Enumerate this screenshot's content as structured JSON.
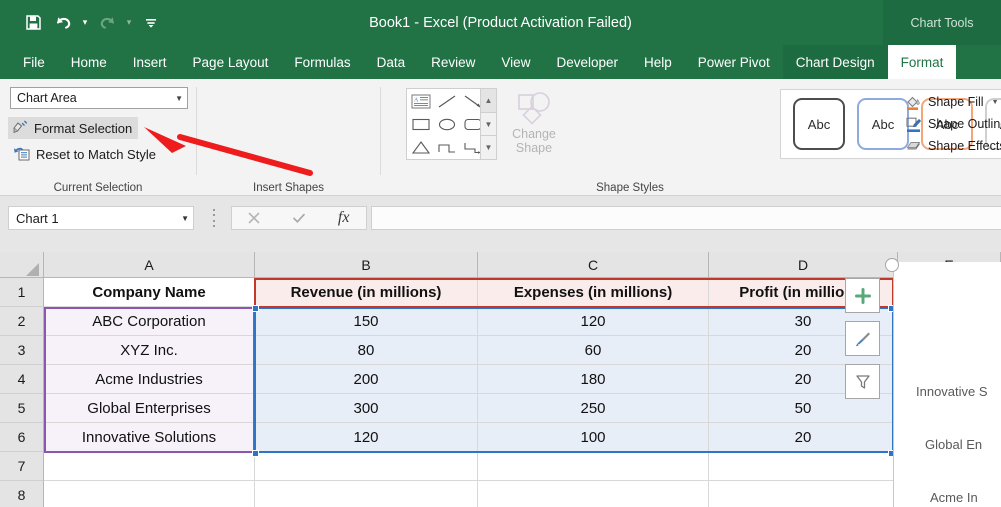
{
  "titlebar": {
    "title": "Book1  -  Excel (Product Activation Failed)",
    "context_tools": "Chart Tools",
    "qat": [
      {
        "name": "save-icon",
        "label": "Save"
      },
      {
        "name": "undo-icon",
        "label": "Undo"
      },
      {
        "name": "undo-dropdown-icon",
        "label": "Undo options"
      },
      {
        "name": "redo-icon",
        "label": "Redo"
      },
      {
        "name": "redo-dropdown-icon",
        "label": "Redo options"
      },
      {
        "name": "customize-qat-icon",
        "label": "Customize Quick Access Toolbar"
      }
    ]
  },
  "tabs": [
    {
      "label": "File",
      "active": false,
      "context": false
    },
    {
      "label": "Home",
      "active": false,
      "context": false
    },
    {
      "label": "Insert",
      "active": false,
      "context": false
    },
    {
      "label": "Page Layout",
      "active": false,
      "context": false
    },
    {
      "label": "Formulas",
      "active": false,
      "context": false
    },
    {
      "label": "Data",
      "active": false,
      "context": false
    },
    {
      "label": "Review",
      "active": false,
      "context": false
    },
    {
      "label": "View",
      "active": false,
      "context": false
    },
    {
      "label": "Developer",
      "active": false,
      "context": false
    },
    {
      "label": "Help",
      "active": false,
      "context": false
    },
    {
      "label": "Power Pivot",
      "active": false,
      "context": false
    },
    {
      "label": "Chart Design",
      "active": false,
      "context": true
    },
    {
      "label": "Format",
      "active": true,
      "context": true
    }
  ],
  "ribbon": {
    "current_selection": {
      "group_label": "Current Selection",
      "selected_object": "Chart Area",
      "format_selection": "Format Selection",
      "reset_to_match_style": "Reset to Match Style"
    },
    "insert_shapes": {
      "group_label": "Insert Shapes",
      "change_shape": "Change Shape",
      "shapes": [
        "textbox-shape-icon",
        "line-shape-icon",
        "arrow-shape-icon",
        "rectangle-shape-icon",
        "oval-shape-icon",
        "rounded-rectangle-shape-icon",
        "triangle-shape-icon",
        "connector-elbow-shape-icon",
        "connector-elbow-arrow-shape-icon"
      ]
    },
    "shape_styles": {
      "group_label": "Shape Styles",
      "sample_text": "Abc",
      "swatches": [
        {
          "border": "#4d4d4d"
        },
        {
          "border": "#8faadc"
        },
        {
          "border": "#f4a67a"
        },
        {
          "border": "#cfcfcf"
        },
        {
          "border": "#f5c342"
        },
        {
          "border": "#8faadc"
        },
        {
          "border": "#a9d18e"
        }
      ],
      "commands": [
        {
          "label": "Shape Fill",
          "icon": "shape-fill-icon",
          "accent": "#ed7d31"
        },
        {
          "label": "Shape Outline",
          "icon": "shape-outline-icon",
          "accent": "#2e75c7"
        },
        {
          "label": "Shape Effects",
          "icon": "shape-effects-icon",
          "accent": "#9a9a9a"
        }
      ]
    }
  },
  "formula_bar": {
    "name_box": "Chart 1",
    "formula_value": "",
    "cancel_icon": "cancel-icon",
    "enter_icon": "enter-checkmark-icon",
    "function_icon": "insert-function-icon"
  },
  "sheet": {
    "column_headers": [
      "A",
      "B",
      "C",
      "D",
      "E"
    ],
    "row_headers": [
      "1",
      "2",
      "3",
      "4",
      "5",
      "6",
      "7",
      "8"
    ],
    "header_row": [
      "Company Name",
      "Revenue (in millions)",
      "Expenses (in millions)",
      "Profit (in millions)"
    ],
    "rows": [
      {
        "row": "2",
        "cells": [
          "ABC Corporation",
          "150",
          "120",
          "30"
        ]
      },
      {
        "row": "3",
        "cells": [
          "XYZ Inc.",
          "80",
          "60",
          "20"
        ]
      },
      {
        "row": "4",
        "cells": [
          "Acme Industries",
          "200",
          "180",
          "20"
        ]
      },
      {
        "row": "5",
        "cells": [
          "Global Enterprises",
          "300",
          "250",
          "50"
        ]
      },
      {
        "row": "6",
        "cells": [
          "Innovative Solutions",
          "120",
          "100",
          "20"
        ]
      }
    ]
  },
  "chart_overlay": {
    "buttons": [
      {
        "name": "chart-elements-button",
        "icon": "plus-icon"
      },
      {
        "name": "chart-styles-button",
        "icon": "brush-icon"
      },
      {
        "name": "chart-filters-button",
        "icon": "funnel-icon"
      }
    ],
    "category_labels": [
      "Innovative S",
      "Global En",
      "Acme In"
    ]
  },
  "annotation": {
    "arrow_color": "#ee1c1c",
    "points_to": "Format Selection"
  }
}
